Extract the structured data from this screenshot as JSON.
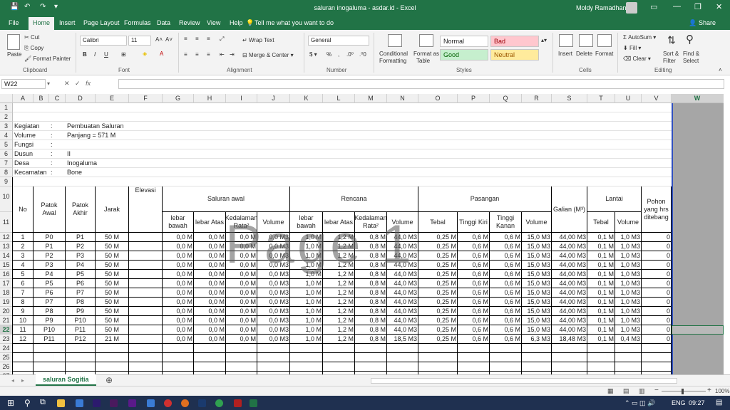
{
  "window": {
    "title": "saluran inogaluma - asdar.id - Excel",
    "user": "Moldy Ramadhan"
  },
  "tabs": [
    "File",
    "Home",
    "Insert",
    "Page Layout",
    "Formulas",
    "Data",
    "Review",
    "View",
    "Help"
  ],
  "tell_me": "Tell me what you want to do",
  "share": "Share",
  "ribbon": {
    "paste": "Paste",
    "cut": "Cut",
    "copy": "Copy",
    "format_painter": "Format Painter",
    "clipboard": "Clipboard",
    "font_name": "Calibri",
    "font_size": "11",
    "font": "Font",
    "wrap_text": "Wrap Text",
    "merge_center": "Merge & Center",
    "alignment": "Alignment",
    "number_format": "General",
    "number": "Number",
    "cond_format_1": "Conditional",
    "cond_format_2": "Formatting",
    "format_table_1": "Format as",
    "format_table_2": "Table",
    "style_normal": "Normal",
    "style_bad": "Bad",
    "style_good": "Good",
    "style_neutral": "Neutral",
    "styles": "Styles",
    "insert": "Insert",
    "delete": "Delete",
    "format": "Format",
    "cells": "Cells",
    "autosum": "AutoSum",
    "fill": "Fill",
    "clear": "Clear",
    "sort_1": "Sort &",
    "sort_2": "Filter",
    "find_1": "Find &",
    "find_2": "Select",
    "editing": "Editing"
  },
  "namebox": "W22",
  "columns": [
    "A",
    "B",
    "C",
    "D",
    "E",
    "F",
    "G",
    "H",
    "I",
    "J",
    "K",
    "L",
    "M",
    "N",
    "O",
    "P",
    "Q",
    "R",
    "S",
    "T",
    "U",
    "V",
    "W"
  ],
  "info": [
    {
      "label": "Kegiatan",
      "sep": ":",
      "value": "Pembuatan Saluran"
    },
    {
      "label": "Volume",
      "sep": ":",
      "value": "Panjang = 571 M"
    },
    {
      "label": "Fungsi",
      "sep": ":",
      "value": ""
    },
    {
      "label": "Dusun",
      "sep": ":",
      "value": "II"
    },
    {
      "label": "Desa",
      "sep": ":",
      "value": "Inogaluma"
    },
    {
      "label": "Kecamatan",
      "sep": ":",
      "value": "Bone"
    }
  ],
  "headers": {
    "no": "No",
    "patok_awal": "Patok Awal",
    "patok_akhir": "Patok Akhir",
    "jarak": "Jarak",
    "elevasi": "Elevasi",
    "saluran_awal": "Saluran awal",
    "rencana": "Rencana",
    "pasangan": "Pasangan",
    "galian": "Galian (M³)",
    "lantai": "Lantai",
    "pohon": "Pohon yang hrs ditebang",
    "lebar_bawah": "lebar bawah",
    "lebar_atas": "lebar Atas",
    "kedalaman": "Kedalaman Rata²",
    "volume": "Volume",
    "tebal": "Tebal",
    "tinggi_kiri": "Tinggi Kiri",
    "tinggi_kanan": "Tinggi Kanan"
  },
  "rows": [
    [
      "1",
      "P0",
      "P1",
      "50 M",
      "",
      "0,0 M",
      "0,0 M",
      "0,0 M",
      "0,0 M3",
      "1,0 M",
      "1,2 M",
      "0,8 M",
      "44,0 M3",
      "0,25 M",
      "0,6 M",
      "0,6 M",
      "15,0 M3",
      "44,00 M3",
      "0,1 M",
      "1,0 M3",
      "0"
    ],
    [
      "2",
      "P1",
      "P2",
      "50 M",
      "",
      "0,0 M",
      "0,0 M",
      "0,0 M",
      "0,0 M3",
      "1,0 M",
      "1,2 M",
      "0,8 M",
      "44,0 M3",
      "0,25 M",
      "0,6 M",
      "0,6 M",
      "15,0 M3",
      "44,00 M3",
      "0,1 M",
      "1,0 M3",
      "0"
    ],
    [
      "3",
      "P2",
      "P3",
      "50 M",
      "",
      "0,0 M",
      "0,0 M",
      "0,0 M",
      "0,0 M3",
      "1,0 M",
      "1,2 M",
      "0,8 M",
      "44,0 M3",
      "0,25 M",
      "0,6 M",
      "0,6 M",
      "15,0 M3",
      "44,00 M3",
      "0,1 M",
      "1,0 M3",
      "0"
    ],
    [
      "4",
      "P3",
      "P4",
      "50 M",
      "",
      "0,0 M",
      "0,0 M",
      "0,0 M",
      "0,0 M3",
      "1,0 M",
      "1,2 M",
      "0,8 M",
      "44,0 M3",
      "0,25 M",
      "0,6 M",
      "0,6 M",
      "15,0 M3",
      "44,00 M3",
      "0,1 M",
      "1,0 M3",
      "0"
    ],
    [
      "5",
      "P4",
      "P5",
      "50 M",
      "",
      "0,0 M",
      "0,0 M",
      "0,0 M",
      "0,0 M3",
      "1,0 M",
      "1,2 M",
      "0,8 M",
      "44,0 M3",
      "0,25 M",
      "0,6 M",
      "0,6 M",
      "15,0 M3",
      "44,00 M3",
      "0,1 M",
      "1,0 M3",
      "0"
    ],
    [
      "6",
      "P5",
      "P6",
      "50 M",
      "",
      "0,0 M",
      "0,0 M",
      "0,0 M",
      "0,0 M3",
      "1,0 M",
      "1,2 M",
      "0,8 M",
      "44,0 M3",
      "0,25 M",
      "0,6 M",
      "0,6 M",
      "15,0 M3",
      "44,00 M3",
      "0,1 M",
      "1,0 M3",
      "0"
    ],
    [
      "7",
      "P6",
      "P7",
      "50 M",
      "",
      "0,0 M",
      "0,0 M",
      "0,0 M",
      "0,0 M3",
      "1,0 M",
      "1,2 M",
      "0,8 M",
      "44,0 M3",
      "0,25 M",
      "0,6 M",
      "0,6 M",
      "15,0 M3",
      "44,00 M3",
      "0,1 M",
      "1,0 M3",
      "0"
    ],
    [
      "8",
      "P7",
      "P8",
      "50 M",
      "",
      "0,0 M",
      "0,0 M",
      "0,0 M",
      "0,0 M3",
      "1,0 M",
      "1,2 M",
      "0,8 M",
      "44,0 M3",
      "0,25 M",
      "0,6 M",
      "0,6 M",
      "15,0 M3",
      "44,00 M3",
      "0,1 M",
      "1,0 M3",
      "0"
    ],
    [
      "9",
      "P8",
      "P9",
      "50 M",
      "",
      "0,0 M",
      "0,0 M",
      "0,0 M",
      "0,0 M3",
      "1,0 M",
      "1,2 M",
      "0,8 M",
      "44,0 M3",
      "0,25 M",
      "0,6 M",
      "0,6 M",
      "15,0 M3",
      "44,00 M3",
      "0,1 M",
      "1,0 M3",
      "0"
    ],
    [
      "10",
      "P9",
      "P10",
      "50 M",
      "",
      "0,0 M",
      "0,0 M",
      "0,0 M",
      "0,0 M3",
      "1,0 M",
      "1,2 M",
      "0,8 M",
      "44,0 M3",
      "0,25 M",
      "0,6 M",
      "0,6 M",
      "15,0 M3",
      "44,00 M3",
      "0,1 M",
      "1,0 M3",
      "0"
    ],
    [
      "11",
      "P10",
      "P11",
      "50 M",
      "",
      "0,0 M",
      "0,0 M",
      "0,0 M",
      "0,0 M3",
      "1,0 M",
      "1,2 M",
      "0,8 M",
      "44,0 M3",
      "0,25 M",
      "0,6 M",
      "0,6 M",
      "15,0 M3",
      "44,00 M3",
      "0,1 M",
      "1,0 M3",
      "0"
    ],
    [
      "12",
      "P11",
      "P12",
      "21 M",
      "",
      "0,0 M",
      "0,0 M",
      "0,0 M",
      "0,0 M3",
      "1,0 M",
      "1,2 M",
      "0,8 M",
      "18,5 M3",
      "0,25 M",
      "0,6 M",
      "0,6 M",
      "6,3 M3",
      "18,48 M3",
      "0,1 M",
      "0,4 M3",
      "0"
    ]
  ],
  "watermark": "Page 1",
  "sheet_tab": "saluran Sogitia",
  "zoom": "100%",
  "taskbar": {
    "lang": "ENG",
    "time": "09:27"
  },
  "colors": {
    "excel_green": "#217346",
    "bad": "#ffc7ce",
    "good": "#c6efce",
    "neutral": "#ffeb9c"
  }
}
